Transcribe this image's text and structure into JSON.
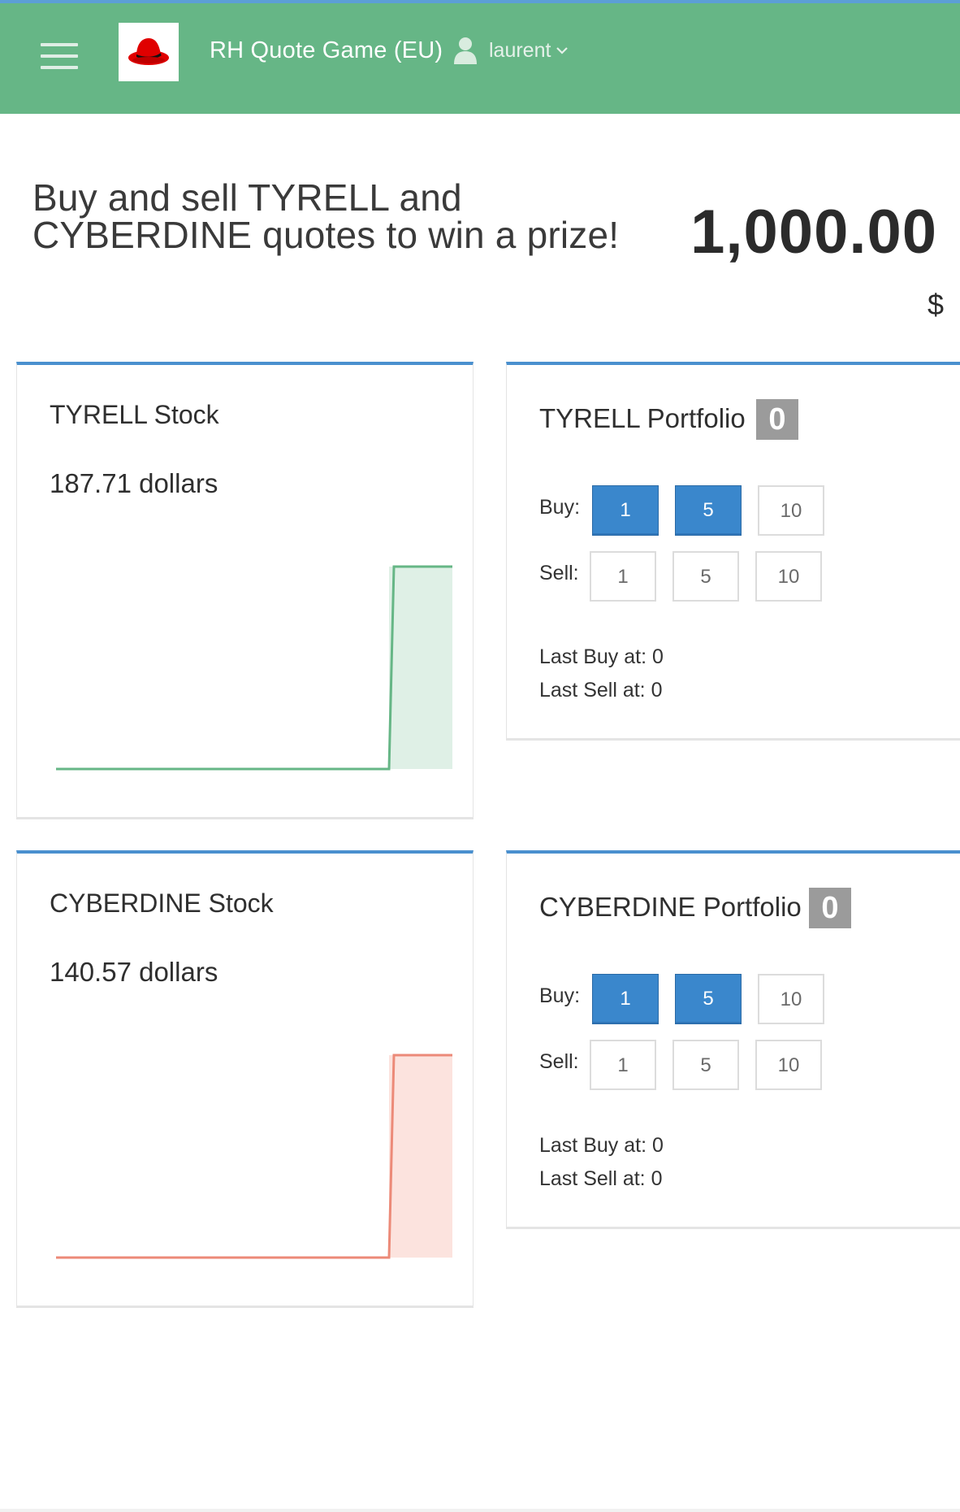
{
  "navbar": {
    "title": "RH Quote Game (EU)",
    "user": "laurent",
    "icons": {
      "menu": "hamburger-menu-icon",
      "logo": "red-hat-logo",
      "user": "user-icon",
      "caret": "chevron-down-icon"
    },
    "color": "#66b686"
  },
  "hero": {
    "line1": "Buy and sell TYRELL and",
    "line2": "CYBERDINE quotes to win a prize!",
    "balance": "1,000.00",
    "currency": "$"
  },
  "stocks": [
    {
      "name": "TYRELL Stock",
      "price": "187.71 dollars",
      "color": "#66b686",
      "fill": "#dff0e6"
    },
    {
      "name": "CYBERDINE Stock",
      "price": "140.57 dollars",
      "color": "#ec8a78",
      "fill": "#fce3de"
    }
  ],
  "portfolios": [
    {
      "title": "TYRELL Portfolio",
      "count": "0",
      "buy_label": "Buy:",
      "sell_label": "Sell:",
      "buy": [
        "1",
        "5",
        "10"
      ],
      "sell": [
        "1",
        "5",
        "10"
      ],
      "last_buy": "Last Buy at: 0",
      "last_sell": "Last Sell at: 0"
    },
    {
      "title": "CYBERDINE Portfolio",
      "count": "0",
      "buy_label": "Buy:",
      "sell_label": "Sell:",
      "buy": [
        "1",
        "5",
        "10"
      ],
      "sell": [
        "1",
        "5",
        "10"
      ],
      "last_buy": "Last Buy at: 0",
      "last_sell": "Last Sell at: 0"
    }
  ],
  "accent": "#4a90cf",
  "button_active": "#3a87cc"
}
